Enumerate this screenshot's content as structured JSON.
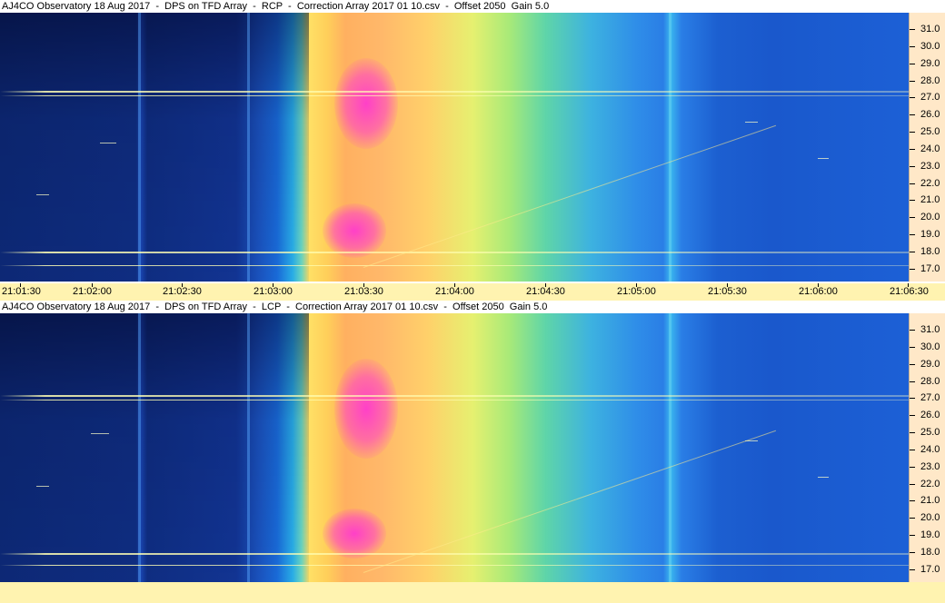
{
  "panels": [
    {
      "title": "AJ4CO Observatory 18 Aug 2017  -  DPS on TFD Array  -  RCP  -  Correction Array 2017 01 10.csv  -  Offset 2050  Gain 5.0"
    },
    {
      "title": "AJ4CO Observatory 18 Aug 2017  -  DPS on TFD Array  -  LCP  -  Correction Array 2017 01 10.csv  -  Offset 2050  Gain 5.0"
    }
  ],
  "freq_axis": {
    "labels": [
      "31.0",
      "30.0",
      "29.0",
      "28.0",
      "27.0",
      "26.0",
      "25.0",
      "24.0",
      "23.0",
      "22.0",
      "21.0",
      "20.0",
      "19.0",
      "18.0",
      "17.0"
    ]
  },
  "time_axis": {
    "labels": [
      "21:01:30",
      "21:02:00",
      "21:02:30",
      "21:03:00",
      "21:03:30",
      "21:04:00",
      "21:04:30",
      "21:05:00",
      "21:05:30",
      "21:06:00",
      "21:06:30"
    ]
  },
  "colors": {
    "axis_bg_freq": "#ffe8c8",
    "axis_bg_time": "#fff3b0",
    "low_power": "#0d2a7a",
    "high_power": "#ff40c8"
  }
}
